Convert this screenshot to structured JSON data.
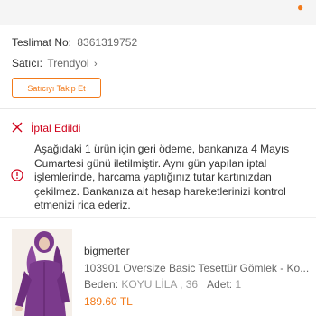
{
  "order": {
    "delivery_label": "Teslimat No:",
    "delivery_number": "8361319752",
    "seller_label": "Satıcı:",
    "seller_name": "Trendyol",
    "follow_button": "Satıcıyı Takip Et"
  },
  "status": {
    "label": "İptal Edildi",
    "color": "#d0021b"
  },
  "refund_message": "Aşağıdaki 1 ürün için geri ödeme, bankanıza 4 Mayıs Cumartesi günü iletilmiştir. Aynı gün yapılan iptal işlemlerinde, harcama yaptığınız tutar kartınızdan çekilmez. Bankanıza ait hesap hareketlerinizi kontrol etmenizi rica ederiz.",
  "product": {
    "brand": "bigmerter",
    "name": "103901 Oversize Basic Tesettür Gömlek - Ko...",
    "size_label": "Beden:",
    "size_value": "KOYU LİLA , 36",
    "qty_label": "Adet:",
    "qty_value": "1",
    "price": "189.60 TL"
  },
  "colors": {
    "accent": "#f27a1a",
    "cancel": "#d0021b",
    "product_color": "#7b3a8c"
  }
}
